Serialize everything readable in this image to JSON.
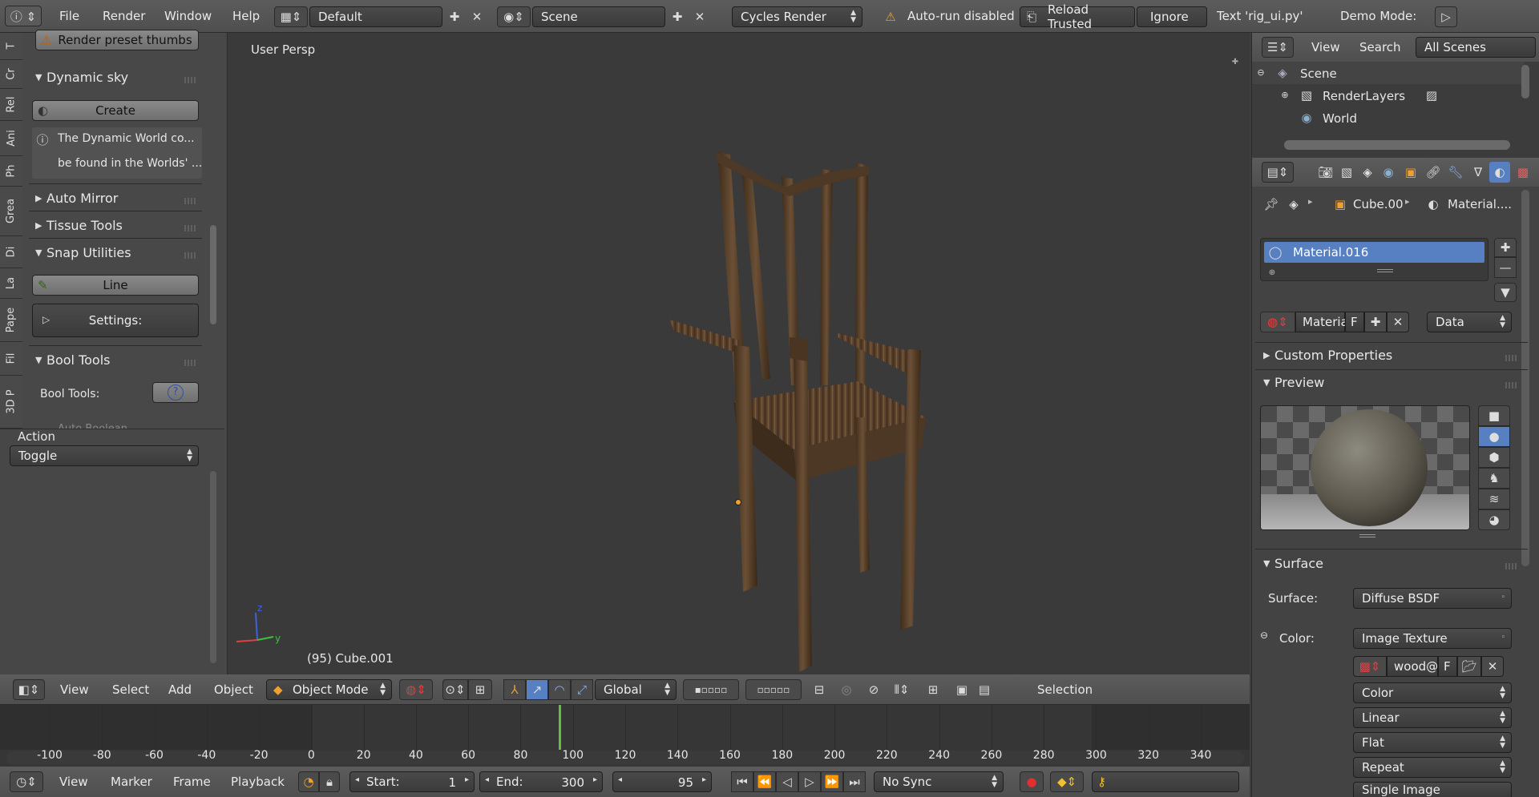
{
  "topbar": {
    "menus": [
      "File",
      "Render",
      "Window",
      "Help"
    ],
    "layout": "Default",
    "scene": "Scene",
    "engine": "Cycles Render",
    "warning": "Auto-run disabled",
    "reload": "Reload Trusted",
    "ignore": "Ignore",
    "text_file": "Text 'rig_ui.py'",
    "demo": "Demo Mode:"
  },
  "toolshelf": {
    "tabs": [
      "T",
      "Cr",
      "Rel",
      "Ani",
      "Ph",
      "Grea",
      "Di",
      "La",
      "Pape",
      "Fil",
      "3D P"
    ],
    "render_preset": "Render preset thumbs",
    "dynamic_sky": "Dynamic sky",
    "create": "Create",
    "info1": "The Dynamic World co...",
    "info2": "be found in the Worlds' ...",
    "auto_mirror": "Auto Mirror",
    "tissue_tools": "Tissue Tools",
    "snap_utilities": "Snap Utilities",
    "line": "Line",
    "settings": "Settings:",
    "bool_tools": "Bool Tools",
    "bool_tools_label": "Bool Tools:",
    "auto_boolean": "Auto Boolean",
    "action_label": "Action",
    "action_value": "Toggle"
  },
  "viewport": {
    "persp": "User Persp",
    "object_info": "(95) Cube.001",
    "menus": [
      "View",
      "Select",
      "Add",
      "Object"
    ],
    "mode": "Object Mode",
    "orientation": "Global",
    "selection": "Selection"
  },
  "timeline": {
    "ticks": [
      "-100",
      "-80",
      "-60",
      "-40",
      "-20",
      "0",
      "20",
      "40",
      "60",
      "80",
      "100",
      "120",
      "140",
      "160",
      "180",
      "200",
      "220",
      "240",
      "260",
      "280",
      "300",
      "320",
      "340"
    ],
    "current_frame_marker": 95,
    "menus": [
      "View",
      "Marker",
      "Frame",
      "Playback"
    ],
    "start_label": "Start:",
    "start": "1",
    "end_label": "End:",
    "end": "300",
    "current": "95",
    "sync": "No Sync"
  },
  "outliner": {
    "menus": [
      "View",
      "Search"
    ],
    "scope": "All Scenes",
    "items": [
      "Scene",
      "RenderLayers",
      "World"
    ]
  },
  "properties": {
    "breadcrumb_obj": "Cube.00",
    "breadcrumb_mat": "Material....",
    "material_slot": "Material.016",
    "mat_name": "Materia",
    "f_label": "F",
    "link": "Data",
    "custom_props": "Custom Properties",
    "preview": "Preview",
    "surface": "Surface",
    "surface_label": "Surface:",
    "surface_value": "Diffuse BSDF",
    "color_label": "Color:",
    "color_value": "Image Texture",
    "image_name": "wood@",
    "options": [
      "Color",
      "Linear",
      "Flat",
      "Repeat",
      "Single Image"
    ]
  },
  "colors": {
    "accent": "#5680c2",
    "current_frame": "#5fbf3f",
    "origin": "#f0a030"
  }
}
